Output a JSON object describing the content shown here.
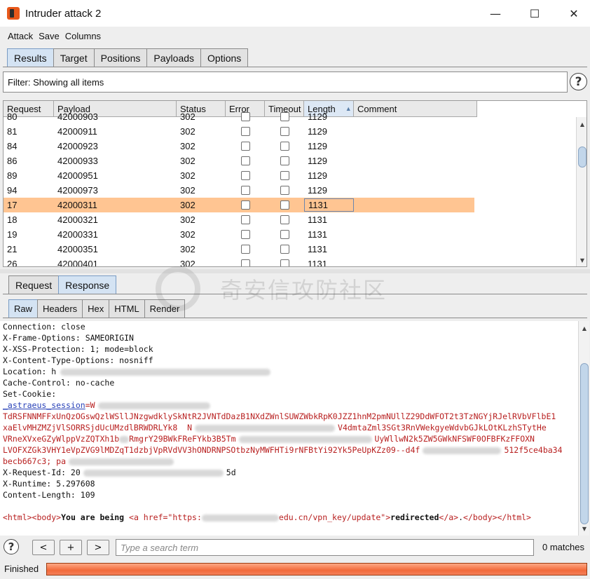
{
  "window": {
    "title": "Intruder attack 2",
    "minimize": "—",
    "maximize": "☐",
    "close": "✕"
  },
  "menu": [
    "Attack",
    "Save",
    "Columns"
  ],
  "main_tabs": [
    "Results",
    "Target",
    "Positions",
    "Payloads",
    "Options"
  ],
  "filter": {
    "text": "Filter: Showing all items",
    "help": "?"
  },
  "table": {
    "columns": [
      "Request",
      "Payload",
      "Status",
      "Error",
      "Timeout",
      "Length",
      "Comment"
    ],
    "sorted_column": "Length",
    "rows": [
      {
        "request": "80",
        "payload": "42000903",
        "status": "302",
        "length": "1129"
      },
      {
        "request": "81",
        "payload": "42000911",
        "status": "302",
        "length": "1129"
      },
      {
        "request": "84",
        "payload": "42000923",
        "status": "302",
        "length": "1129"
      },
      {
        "request": "86",
        "payload": "42000933",
        "status": "302",
        "length": "1129"
      },
      {
        "request": "89",
        "payload": "42000951",
        "status": "302",
        "length": "1129"
      },
      {
        "request": "94",
        "payload": "42000973",
        "status": "302",
        "length": "1129"
      },
      {
        "request": "17",
        "payload": "42000311",
        "status": "302",
        "length": "1131",
        "selected": true
      },
      {
        "request": "18",
        "payload": "42000321",
        "status": "302",
        "length": "1131"
      },
      {
        "request": "19",
        "payload": "42000331",
        "status": "302",
        "length": "1131"
      },
      {
        "request": "21",
        "payload": "42000351",
        "status": "302",
        "length": "1131"
      },
      {
        "request": "26",
        "payload": "42000401",
        "status": "302",
        "length": "1131"
      }
    ]
  },
  "reqresp_tabs": [
    "Request",
    "Response"
  ],
  "view_tabs": [
    "Raw",
    "Headers",
    "Hex",
    "HTML",
    "Render"
  ],
  "watermark": "奇安信攻防社区",
  "response": {
    "connection": "Connection: close",
    "xfo": "X-Frame-Options: SAMEORIGIN",
    "xxss": "X-XSS-Protection: 1; mode=block",
    "xcto": "X-Content-Type-Options: nosniff",
    "location": "Location: h",
    "cache": "Cache-Control: no-cache",
    "setcookie": "Set-Cookie:",
    "cookie_name": "_astraeus_session",
    "cookie1": "=W",
    "cookie2": "TdRSFNNMFFxUnQzOGswQzlWSllJNzgwdklySkNtR2JVNTdDazB1NXdZWnlSUWZWbkRpK0JZZ1hnM2pmNUllZ29DdWFOT2t3TzNGYjRJelRVbVFlbE1",
    "cookie3a": "xaElvMHZMZjVlSORRSjdUcUMzdlBRWDRLYk8  N",
    "cookie3b": "V4dmtaZml3SGt3RnVWekgyeWdvbGJkLOtKLzhSTytHe",
    "cookie4": "VRneXVxeGZyWlppVzZQTXh1b",
    "cookie4b": "RmgrY29BWkFReFYkb3B5Tm",
    "cookie4c": "UyWllwN2k5ZW5GWkNFSWF0OFBFKzFFOXN",
    "cookie5": "LVOFXZGk3VHY1eVpZVG9lMDZqT1dzbjVpRVdVV3hONDRNPSOtbzNyMWFHTi9rNFBtYi92Yk5PeUpKZz09--d4f",
    "cookie5b": "512f5ce4ba34",
    "cookie6": "becb667c3; pa",
    "reqid": "X-Request-Id: 20",
    "reqid_end": "5d",
    "runtime": "X-Runtime: 5.297608",
    "clen": "Content-Length: 109",
    "body_open": "<html><body>",
    "body_text": "You are being ",
    "a_open": "<a href=\"https:",
    "url_end": "edu.cn/vpn_key/update\"",
    "gt": ">",
    "redirected": "redirected",
    "a_close": "</a>",
    "dot": ".",
    "body_close": "</body></html>"
  },
  "search": {
    "help": "?",
    "prev": "<",
    "add": "+",
    "next": ">",
    "placeholder": "Type a search term",
    "matches": "0 matches"
  },
  "status": {
    "text": "Finished",
    "progress": 1.0
  }
}
